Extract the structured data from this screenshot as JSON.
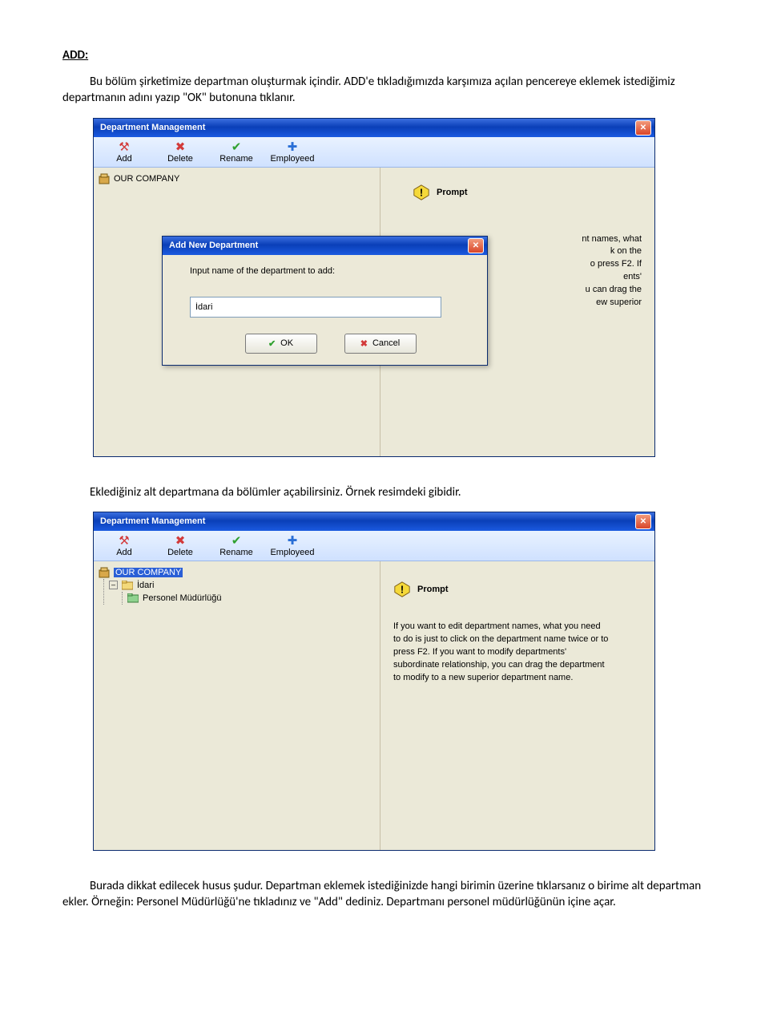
{
  "doc": {
    "heading": "ADD:",
    "para1": "Bu bölüm şirketimize departman oluşturmak içindir. ADD'e tıkladığımızda karşımıza açılan pencereye eklemek istediğimiz departmanın adını yazıp \"OK\" butonuna tıklanır.",
    "para2": "Eklediğiniz alt departmana da bölümler açabilirsiniz. Örnek resimdeki gibidir.",
    "para3": "Burada dikkat edilecek husus şudur. Departman eklemek istediğinizde hangi birimin üzerine tıklarsanız o birime alt departman ekler. Örneğin: Personel Müdürlüğü'ne tıkladınız ve \"Add\" dediniz. Departmanı personel müdürlüğünün içine açar."
  },
  "win": {
    "title": "Department Management",
    "toolbar": [
      {
        "icon": "add-icon",
        "label": "Add",
        "glyph": "⚒",
        "cls": "ic-add"
      },
      {
        "icon": "delete-icon",
        "label": "Delete",
        "glyph": "✖",
        "cls": "ic-del"
      },
      {
        "icon": "rename-icon",
        "label": "Rename",
        "glyph": "✔",
        "cls": "ic-ren"
      },
      {
        "icon": "employeed-icon",
        "label": "Employeed",
        "glyph": "✚",
        "cls": "ic-emp"
      }
    ],
    "root_node": "OUR COMPANY",
    "prompt_partial": "Prompt",
    "right_fragment": {
      "l1": "nt names, what",
      "l2": "k on the",
      "l3": "o press F2. If",
      "l4": "ents'",
      "l5": "u can drag the",
      "l6": "ew superior"
    }
  },
  "dialog": {
    "title": "Add New Department",
    "label": "Input name of the department to add:",
    "value": "İdari",
    "ok": "OK",
    "cancel": "Cancel"
  },
  "win2": {
    "nodes": {
      "root": "OUR COMPANY",
      "child1": "İdari",
      "child2": "Personel Müdürlüğü"
    },
    "prompt_title": "Prompt",
    "prompt_text": "If you want to edit department names, what you need to do is just to click on the department name twice or to press F2. If you want to modify departments' subordinate relationship, you can drag the department to modify to a new superior department name."
  }
}
